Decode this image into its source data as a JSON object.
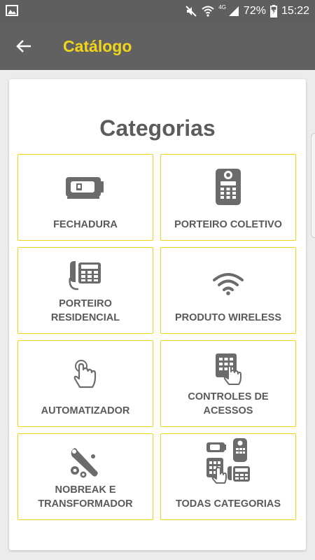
{
  "status_bar": {
    "battery_percent": "72%",
    "time": "15:22",
    "network_type": "4G"
  },
  "app_bar": {
    "title": "Catálogo"
  },
  "main": {
    "heading": "Categorias",
    "categories": [
      {
        "label": "FECHADURA",
        "icon": "door-lock-icon"
      },
      {
        "label": "PORTEIRO COLETIVO",
        "icon": "intercom-panel-icon"
      },
      {
        "label": "PORTEIRO\nRESIDENCIAL",
        "icon": "desk-phone-icon"
      },
      {
        "label": "PRODUTO WIRELESS",
        "icon": "wifi-icon"
      },
      {
        "label": "AUTOMATIZADOR",
        "icon": "touch-hand-icon"
      },
      {
        "label": "CONTROLES DE\nACESSOS",
        "icon": "keypad-access-icon"
      },
      {
        "label": "NOBREAK E\nTRANSFORMADOR",
        "icon": "wrench-gears-icon"
      },
      {
        "label": "TODAS CATEGORIAS",
        "icon": "all-categories-icon"
      }
    ]
  },
  "colors": {
    "accent": "#f2d51a",
    "appbar": "#616161",
    "icon": "#6b6b6b",
    "text": "#5a5a5a"
  }
}
